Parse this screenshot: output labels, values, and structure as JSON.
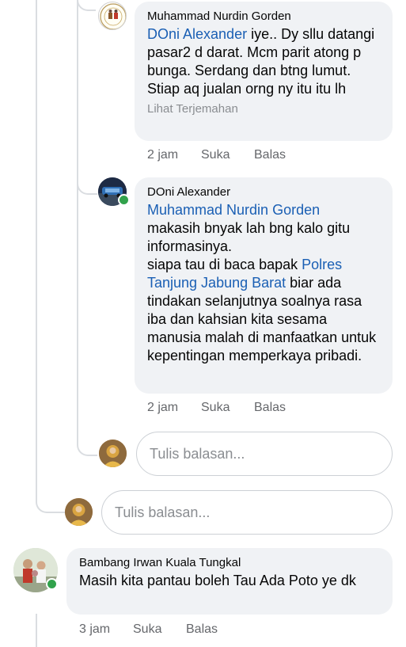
{
  "comments": [
    {
      "author": "Muhammad Nurdin Gorden",
      "mention": "DOni Alexander",
      "text": " iye.. Dy sllu datangi pasar2 d darat. Mcm parit atong p bunga. Serdang dan btng lumut. Stiap aq jualan orng ny itu itu lh",
      "translate": "Lihat Terjemahan",
      "time": "2 jam",
      "like": "Suka",
      "reply": "Balas",
      "avatar_icon": "profile-photo-logo"
    },
    {
      "author": "DOni Alexander",
      "mention": "Muhammad Nurdin Gorden",
      "text_1": "makasih bnyak lah bng kalo gitu informasinya.",
      "text_2": "siapa tau di baca bapak ",
      "mention_2": "Polres Tanjung Jabung Barat",
      "text_3": "  biar ada tindakan selanjutnya soalnya rasa iba dan kahsian kita sesama manusia malah di manfaatkan untuk kepentingan memperkaya pribadi.",
      "time": "2 jam",
      "like": "Suka",
      "reply": "Balas",
      "avatar_icon": "profile-photo-car",
      "online": true
    },
    {
      "author": "Bambang Irwan Kuala Tungkal",
      "text": "Masih kita pantau boleh Tau Ada Poto ye dk",
      "time": "3 jam",
      "like": "Suka",
      "reply": "Balas",
      "avatar_icon": "profile-photo-group",
      "online": true
    }
  ],
  "reply_inputs": [
    {
      "placeholder": "Tulis balasan..."
    },
    {
      "placeholder": "Tulis balasan..."
    }
  ],
  "colors": {
    "bubble": "#f0f2f5",
    "mention": "#1a5fb4",
    "online": "#31a24c",
    "secondary_text": "#65676b"
  }
}
